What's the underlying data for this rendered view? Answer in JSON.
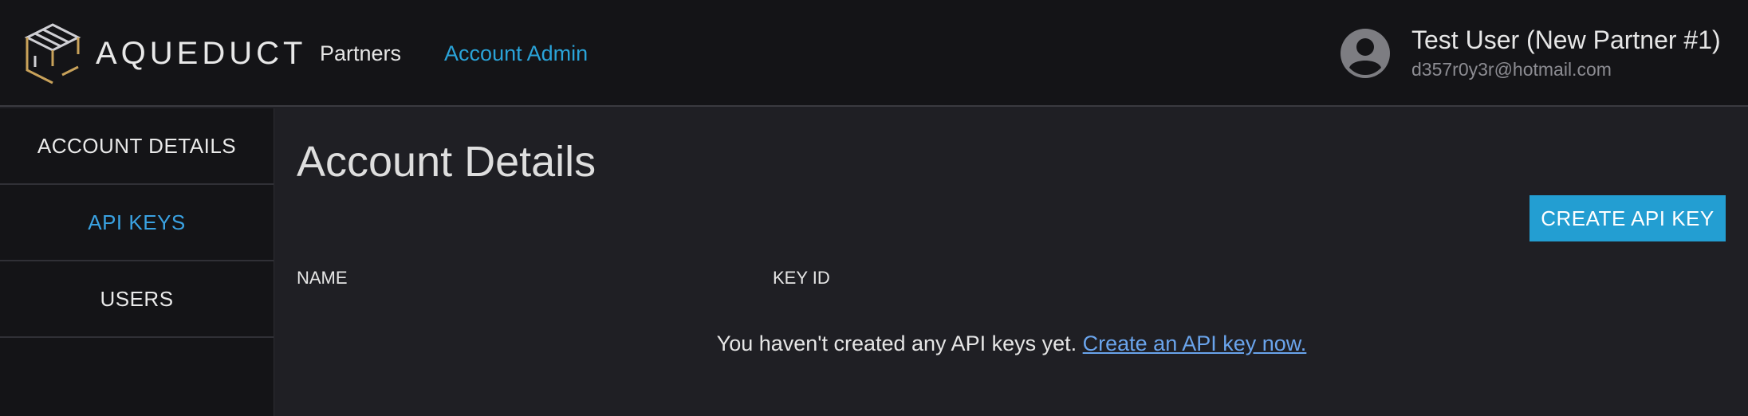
{
  "brand": {
    "name": "AQUEDUCT",
    "logo_icon": "aqueduct-logo-icon"
  },
  "topnav": {
    "items": [
      {
        "label": "Partners",
        "active": false
      },
      {
        "label": "Account Admin",
        "active": true
      }
    ]
  },
  "user": {
    "name": "Test User (New Partner #1)",
    "email": "d357r0y3r@hotmail.com",
    "avatar_icon": "user-circle-icon"
  },
  "sidebar": {
    "items": [
      {
        "label": "ACCOUNT DETAILS",
        "active": false
      },
      {
        "label": "API KEYS",
        "active": true
      },
      {
        "label": "USERS",
        "active": false
      }
    ]
  },
  "main": {
    "title": "Account Details",
    "create_button_label": "CREATE API KEY",
    "columns": [
      "NAME",
      "KEY ID"
    ],
    "empty_message": "You haven't created any API keys yet.",
    "empty_link": "Create an API key now."
  },
  "colors": {
    "accent": "#239ed2",
    "link": "#6aa4ec",
    "active_nav": "#2aa3d8",
    "background": "#1f1f24",
    "chrome": "#141417"
  }
}
